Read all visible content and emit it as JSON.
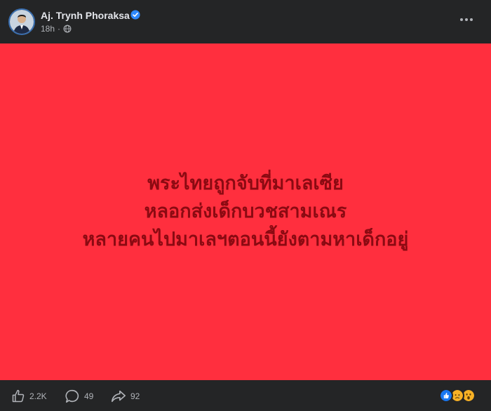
{
  "post": {
    "author": "Aj. Trynh Phoraksa",
    "timestamp": "18h",
    "separator": "·",
    "audience_icon": "globe-icon",
    "verified_icon": "verified-badge-icon",
    "more_icon": "more-options-icon"
  },
  "image_text": {
    "line1": "พระไทยถูกจับที่มาเลเซีย",
    "line2": "หลอกส่งเด็กบวชสามเณร",
    "line3": "หลายคนไปมาเลฯตอนนี้ยังตามหาเด็กอยู่"
  },
  "footer": {
    "likes": "2.2K",
    "comments": "49",
    "shares": "92",
    "reaction_icons": [
      "like-reaction-icon",
      "sad-reaction-icon",
      "wow-reaction-icon"
    ]
  },
  "colors": {
    "background": "#242526",
    "image_background": "#ff2f3e",
    "image_text": "#8b0a12",
    "verified": "#2d88ff"
  }
}
